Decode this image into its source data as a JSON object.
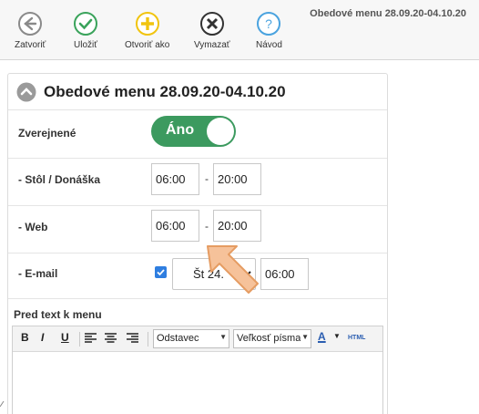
{
  "toolbar": {
    "title": "Obedové menu 28.09.20-04.10.20",
    "buttons": [
      {
        "label": "Zatvoriť",
        "icon": "back-arrow-icon",
        "color": "#8a8a8a"
      },
      {
        "label": "Uložiť",
        "icon": "checkmark-icon",
        "color": "#3aa35b"
      },
      {
        "label": "Otvoriť ako",
        "icon": "plus-icon",
        "color": "#f1c40f"
      },
      {
        "label": "Vymazať",
        "icon": "x-icon",
        "color": "#333333"
      },
      {
        "label": "Návod",
        "icon": "help-icon",
        "color": "#4aa3df"
      }
    ]
  },
  "panel": {
    "title": "Obedové menu 28.09.20-04.10.20",
    "collapse_icon": "chevron-up-icon"
  },
  "fields": {
    "published": {
      "label": "Zverejnené",
      "toggle_text": "Áno",
      "on": true,
      "color": "#3c9a5f"
    },
    "table_delivery": {
      "label": "- Stôl / Donáška",
      "from": "06:00",
      "to": "20:00",
      "dash": "-"
    },
    "web": {
      "label": "- Web",
      "from": "06:00",
      "to": "20:00",
      "dash": "-"
    },
    "email": {
      "label": "- E-mail",
      "checked": true,
      "day": "Št 24.",
      "time": "06:00"
    }
  },
  "editor": {
    "label": "Pred text k menu",
    "bold": "B",
    "italic": "I",
    "underline": "U",
    "format_select": "Odstavec",
    "size_select": "Veľkosť písma",
    "color_letter": "A",
    "html_label": "HTML"
  },
  "accent_colors": {
    "callout": "#f6b98a",
    "callout_stroke": "#e59c62"
  }
}
